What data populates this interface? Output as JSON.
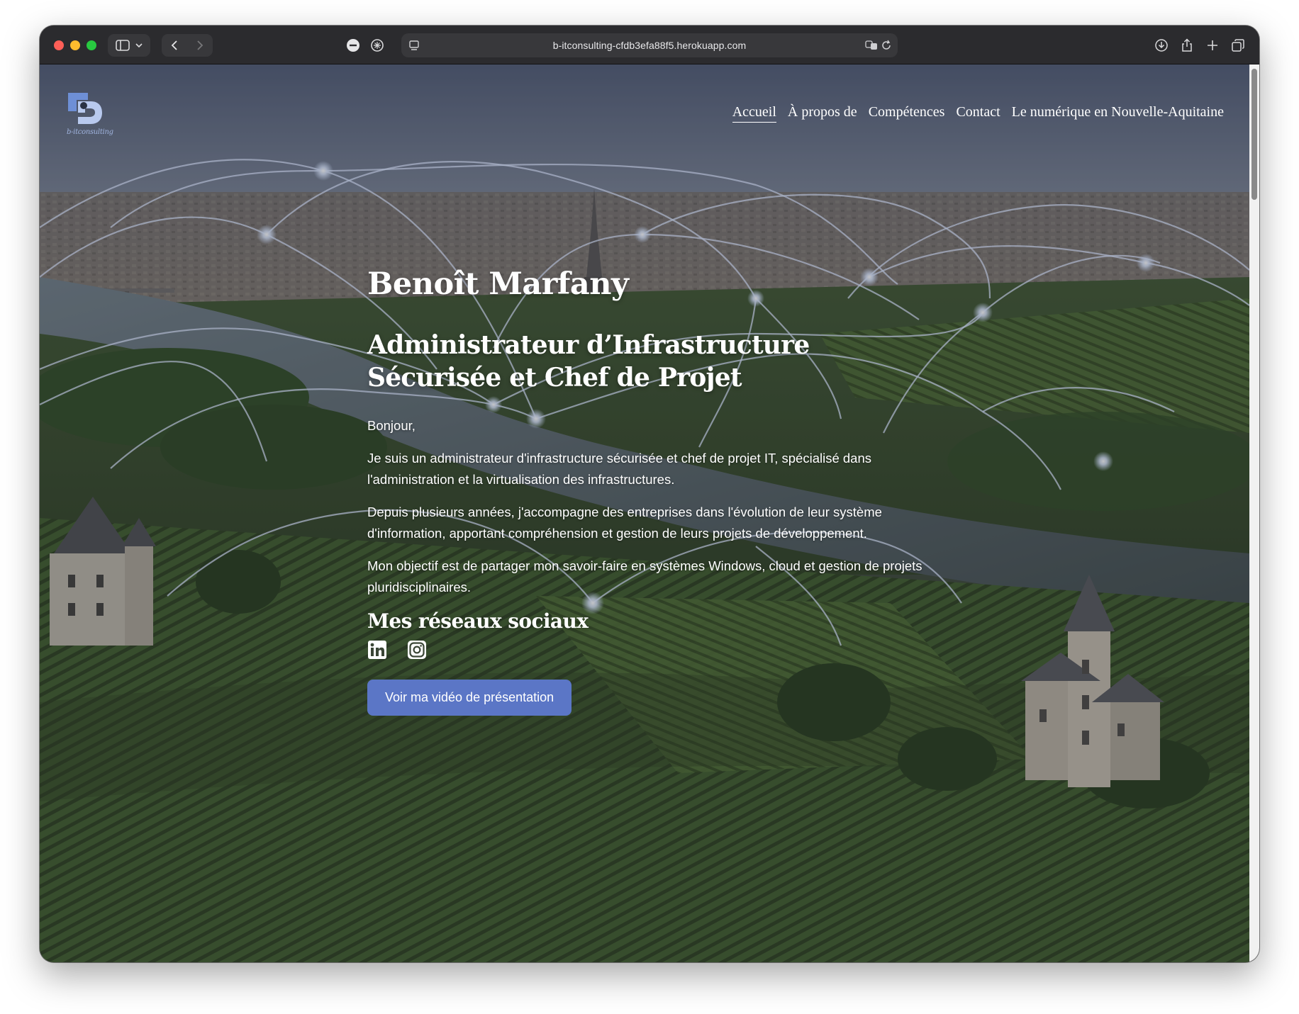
{
  "browser": {
    "url": "b-itconsulting-cfdb3efa88f5.herokuapp.com"
  },
  "site": {
    "logo_text": "b-itconsulting",
    "nav": [
      {
        "label": "Accueil",
        "active": true
      },
      {
        "label": "À propos de",
        "active": false
      },
      {
        "label": "Compétences",
        "active": false
      },
      {
        "label": "Contact",
        "active": false
      },
      {
        "label": "Le numérique en Nouvelle-Aquitaine",
        "active": false
      }
    ]
  },
  "hero": {
    "name": "Benoît Marfany",
    "role": "Administrateur d’Infrastructure Sécurisée et Chef de Projet",
    "greeting": "Bonjour,",
    "paragraphs": [
      "Je suis un administrateur d'infrastructure sécurisée et chef de projet IT, spécialisé dans l'administration et la virtualisation des infrastructures.",
      "Depuis plusieurs années, j'accompagne des entreprises dans l'évolution de leur système d'information, apportant compréhension et gestion de leurs projets de développement.",
      "Mon objectif est de partager mon savoir-faire en systèmes Windows, cloud et gestion de projets pluridisciplinaires."
    ],
    "social_title": "Mes réseaux sociaux",
    "social_icons": [
      "linkedin-icon",
      "instagram-icon"
    ],
    "cta_label": "Voir ma vidéo de présentation"
  },
  "colors": {
    "accent": "#5b76c6",
    "titlebar": "#2b2b2e",
    "link_glow": "#cfe0ff"
  }
}
